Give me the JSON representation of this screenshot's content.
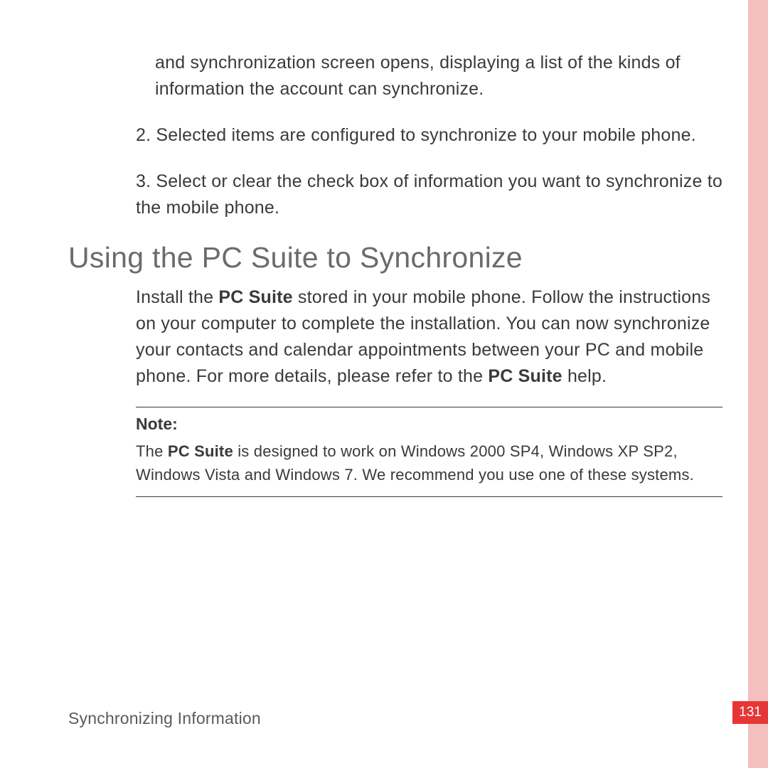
{
  "continuation": "and synchronization screen opens, displaying a list of the kinds of information the account can synchronize.",
  "items": [
    {
      "num": "2.",
      "text": "Selected items are configured to synchronize to your mobile phone."
    },
    {
      "num": "3.",
      "text": "Select or clear the check box of information you want to synchronize to the mobile phone."
    }
  ],
  "heading": "Using the PC Suite to Synchronize",
  "body": {
    "pre": "Install the ",
    "bold1": "PC Suite",
    "mid": " stored in your mobile phone. Follow the instructions on your computer to complete the installation. You can now synchronize your contacts and calendar appointments between your PC and mobile phone. For more details, please refer to the ",
    "bold2": "PC Suite",
    "post": " help."
  },
  "note": {
    "label": "Note:",
    "pre": "The ",
    "bold": "PC Suite",
    "post": " is designed to work on Windows 2000 SP4, Windows XP SP2, Windows Vista and Windows 7. We recommend you use one of these systems."
  },
  "footer": "Synchronizing Information",
  "page": "131"
}
